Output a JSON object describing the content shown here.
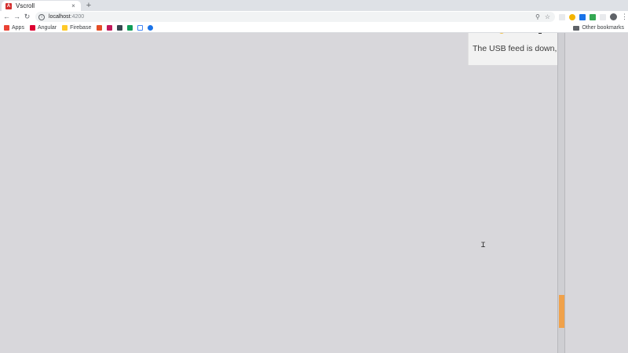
{
  "tab": {
    "title": "Vscroll",
    "close": "×",
    "new": "+"
  },
  "toolbar": {
    "back": "←",
    "forward": "→",
    "reload": "↻",
    "url_host": "localhost",
    "url_port": ":4200",
    "info": "i"
  },
  "bookmarks": {
    "items": [
      {
        "label": "Apps",
        "color": "#ea4335"
      },
      {
        "label": "Angular",
        "color": "#dd0031"
      },
      {
        "label": "Firebase",
        "color": "#ffca28"
      }
    ],
    "icon_colors": [
      "#e44d26",
      "#c2185b",
      "#37474f",
      "#0f9d58",
      "#4285f4",
      "#1a73e8"
    ],
    "other": "Other bookmarks"
  },
  "page": {
    "card_text": "The USB feed is down, pa",
    "scroll_accent": "#f0a14a"
  }
}
